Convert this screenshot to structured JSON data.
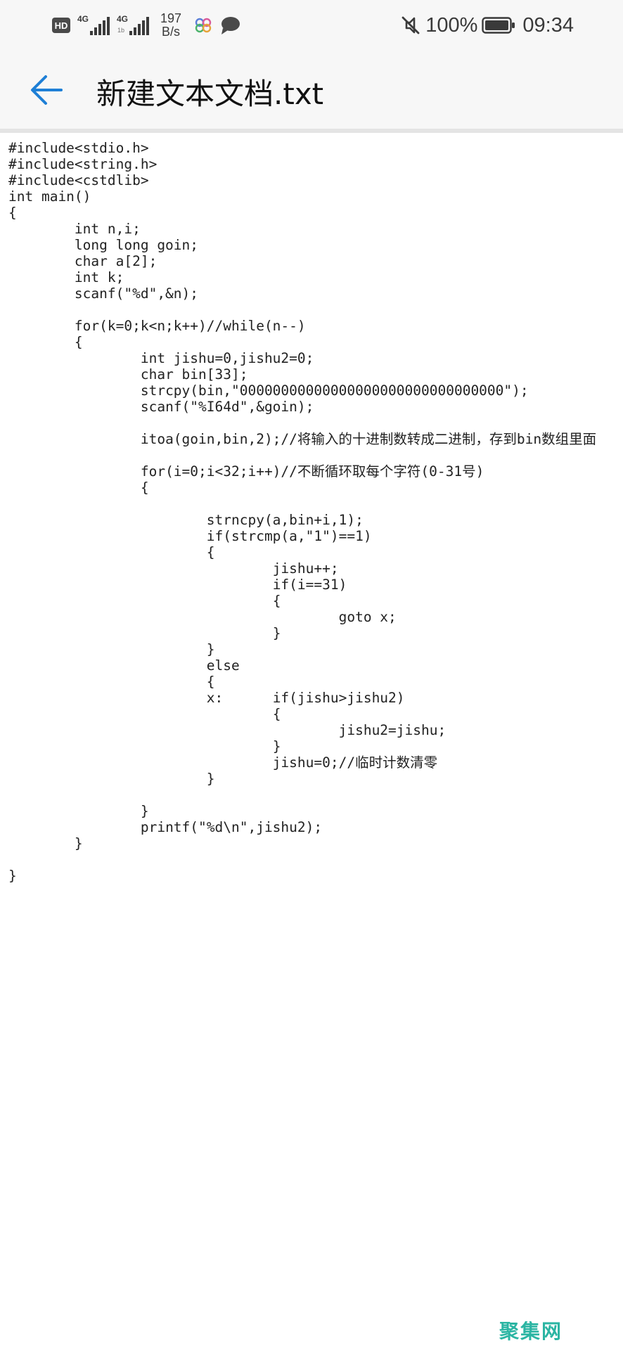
{
  "status_bar": {
    "hd_label": "HD",
    "signal1_label": "4G",
    "signal2_label": "4G",
    "signal2_sub": "1b",
    "speed_value": "197",
    "speed_unit": "B/s",
    "battery_percent": "100%",
    "time": "09:34",
    "icons": [
      "hd-icon",
      "signal-icon",
      "signal-icon",
      "app-notification-icon",
      "chat-bubble-icon",
      "mute-icon",
      "battery-icon"
    ]
  },
  "app_bar": {
    "back_icon": "arrow-left-icon",
    "title": "新建文本文档.txt"
  },
  "document": {
    "lines": [
      "#include<stdio.h>",
      "#include<string.h>",
      "#include<cstdlib>",
      "int main()",
      "{",
      "\tint n,i;",
      "\tlong long goin;",
      "\tchar a[2];",
      "\tint k;",
      "\tscanf(\"%d\",&n);",
      "",
      "\tfor(k=0;k<n;k++)//while(n--)",
      "\t{",
      "\t\tint jishu=0,jishu2=0;",
      "\t\tchar bin[33];",
      "\t\tstrcpy(bin,\"00000000000000000000000000000000\");",
      "\t\tscanf(\"%I64d\",&goin);",
      "",
      "\t\titoa(goin,bin,2);//将输入的十进制数转成二进制，存到bin数组里面",
      "",
      "\t\tfor(i=0;i<32;i++)//不断循环取每个字符(0-31号)",
      "\t\t{",
      "",
      "\t\t\tstrncpy(a,bin+i,1);",
      "\t\t\tif(strcmp(a,\"1\")==1)",
      "\t\t\t{",
      "\t\t\t\tjishu++;",
      "\t\t\t\tif(i==31)",
      "\t\t\t\t{",
      "\t\t\t\t\tgoto x;",
      "\t\t\t\t}",
      "\t\t\t}",
      "\t\t\telse",
      "\t\t\t{",
      "\t\t\tx:\tif(jishu>jishu2)",
      "\t\t\t\t{",
      "\t\t\t\t\tjishu2=jishu;",
      "\t\t\t\t}",
      "\t\t\t\tjishu=0;//临时计数清零",
      "\t\t\t}",
      "",
      "\t\t}",
      "\t\tprintf(\"%d\\n\",jishu2);",
      "\t}",
      "",
      "}"
    ]
  },
  "watermark": {
    "text": "聚集网",
    "color": "#2bb5a3"
  },
  "colors": {
    "accent": "#1e7fd6",
    "bar_background": "#f7f7f7",
    "text": "#222222"
  }
}
